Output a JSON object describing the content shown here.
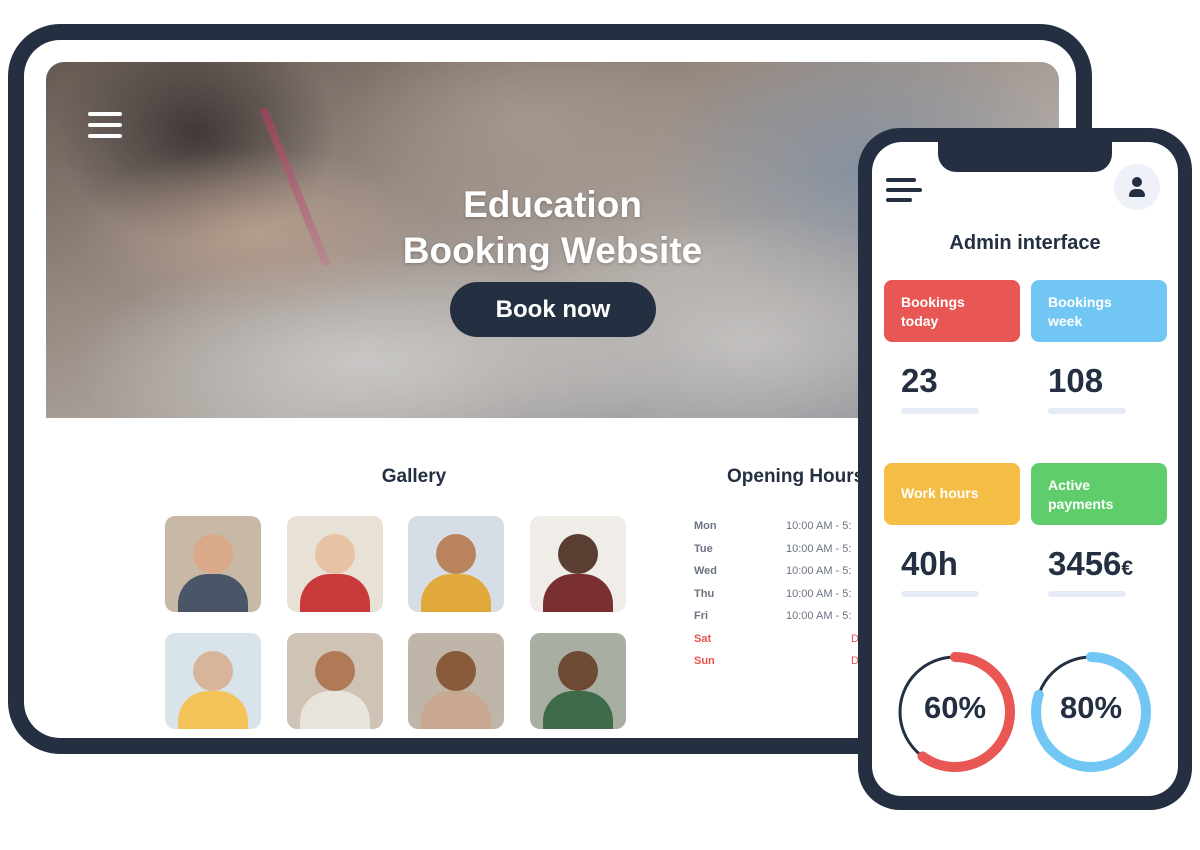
{
  "hero": {
    "title_line1": "Education",
    "title_line2": "Booking Website",
    "cta_label": "Book now"
  },
  "gallery": {
    "title": "Gallery",
    "thumbnails": [
      {
        "bg": "#c7b9a6",
        "face": "#d9a98a",
        "body": "#4a5568"
      },
      {
        "bg": "#e8e2d6",
        "face": "#e8c2a4",
        "body": "#c93a3a"
      },
      {
        "bg": "#d6dde4",
        "face": "#b9835e",
        "body": "#e0a93a"
      },
      {
        "bg": "#f0ede8",
        "face": "#5a3e32",
        "body": "#7a3030"
      },
      {
        "bg": "#d9e4ea",
        "face": "#d8b49a",
        "body": "#f4c45a"
      },
      {
        "bg": "#cfc3b5",
        "face": "#b07a58",
        "body": "#e8e4dc"
      },
      {
        "bg": "#bfb5a8",
        "face": "#8a5a3c",
        "body": "#c8a890"
      },
      {
        "bg": "#a8aea2",
        "face": "#6e4a34",
        "body": "#3e6b4a"
      }
    ]
  },
  "opening_hours": {
    "title": "Opening Hours",
    "rows": [
      {
        "day": "Mon",
        "time": "10:00 AM - 5:",
        "closed": false
      },
      {
        "day": "Tue",
        "time": "10:00 AM - 5:",
        "closed": false
      },
      {
        "day": "Wed",
        "time": "10:00 AM - 5:",
        "closed": false
      },
      {
        "day": "Thu",
        "time": "10:00 AM - 5:",
        "closed": false
      },
      {
        "day": "Fri",
        "time": "10:00 AM - 5:",
        "closed": false
      },
      {
        "day": "Sat",
        "time": "D",
        "closed": true
      },
      {
        "day": "Sun",
        "time": "D",
        "closed": true
      }
    ]
  },
  "admin": {
    "title": "Admin interface",
    "cards": [
      {
        "label_line1": "Bookings",
        "label_line2": "today",
        "value": "23",
        "unit": "",
        "color": "#e85753"
      },
      {
        "label_line1": "Bookings",
        "label_line2": "week",
        "value": "108",
        "unit": "",
        "color": "#72c6f4"
      },
      {
        "label_line1": "Work hours",
        "label_line2": "",
        "value": "40h",
        "unit": "",
        "color": "#f4bd45"
      },
      {
        "label_line1": "Active",
        "label_line2": "payments",
        "value": "3456",
        "unit": "€",
        "color": "#5fcd6c"
      }
    ],
    "gauges": [
      {
        "label": "60%",
        "fraction": 0.6,
        "color": "#e85753"
      },
      {
        "label": "80%",
        "fraction": 0.8,
        "color": "#72c6f4"
      }
    ]
  },
  "colors": {
    "navy": "#243042",
    "stat_bar": "#e4ebf5",
    "closed": "#e8524f"
  }
}
